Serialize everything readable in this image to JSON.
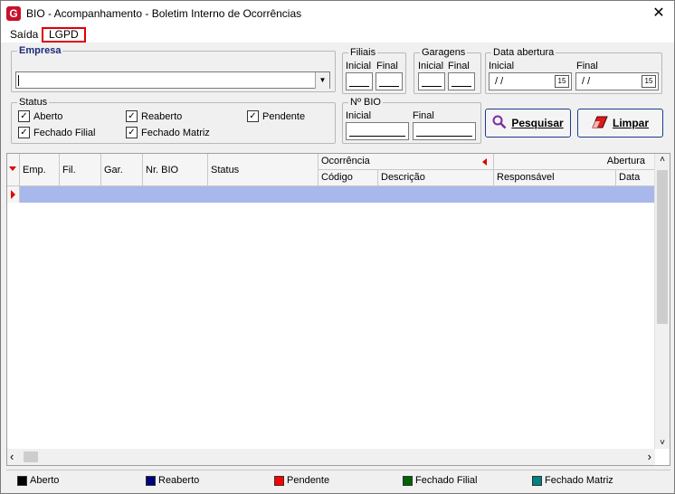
{
  "window": {
    "title": "BIO - Acompanhamento - Boletim Interno de Ocorrências",
    "icon_letter": "G",
    "close_glyph": "✕"
  },
  "menu": {
    "items": [
      {
        "label": "Saída"
      },
      {
        "label": "LGPD"
      }
    ]
  },
  "filters": {
    "empresa": {
      "legend": "Empresa",
      "value": ""
    },
    "filiais": {
      "legend": "Filiais",
      "inicial": "Inicial",
      "final": "Final"
    },
    "garagens": {
      "legend": "Garagens",
      "inicial": "Inicial",
      "final": "Final"
    },
    "data_abertura": {
      "legend": "Data abertura",
      "inicial": "Inicial",
      "final": "Final",
      "inicial_value": " / /",
      "final_value": " / /",
      "cal_glyph": "15"
    },
    "status": {
      "legend": "Status",
      "options": [
        {
          "label": "Aberto",
          "checked": true
        },
        {
          "label": "Reaberto",
          "checked": true
        },
        {
          "label": "Pendente",
          "checked": true
        },
        {
          "label": "Fechado Filial",
          "checked": true
        },
        {
          "label": "Fechado Matriz",
          "checked": true
        }
      ]
    },
    "nr_bio": {
      "legend": "Nº BIO",
      "inicial": "Inicial",
      "final": "Final"
    }
  },
  "actions": {
    "pesquisar": "Pesquisar",
    "limpar": "Limpar"
  },
  "grid": {
    "group_headers": {
      "ocorrencia": "Ocorrência",
      "abertura": "Abertura"
    },
    "columns": [
      "Emp.",
      "Fil.",
      "Gar.",
      "Nr. BIO",
      "Status",
      "Código",
      "Descrição",
      "Responsável",
      "Data"
    ],
    "scroll_left": "‹",
    "scroll_right": "›",
    "scroll_up": "˄",
    "scroll_down": "˅"
  },
  "legend": {
    "items": [
      {
        "label": "Aberto",
        "color": "#000000"
      },
      {
        "label": "Reaberto",
        "color": "#000080"
      },
      {
        "label": "Pendente",
        "color": "#ff0000"
      },
      {
        "label": "Fechado Filial",
        "color": "#006400"
      },
      {
        "label": "Fechado Matriz",
        "color": "#008080"
      }
    ]
  }
}
